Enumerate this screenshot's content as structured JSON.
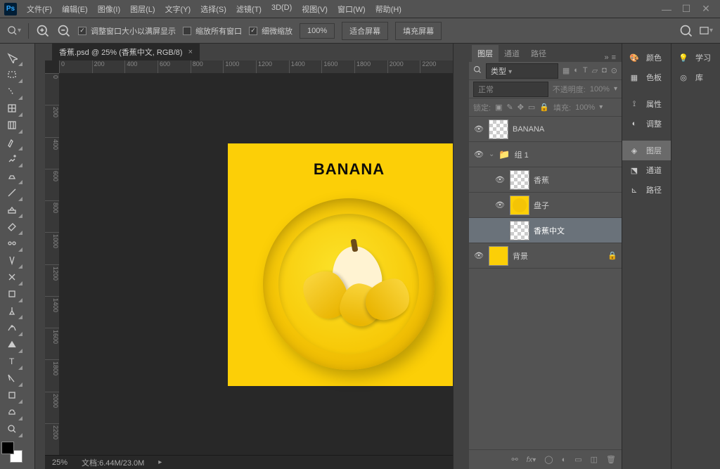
{
  "menubar": {
    "items": [
      "文件(F)",
      "编辑(E)",
      "图像(I)",
      "图层(L)",
      "文字(Y)",
      "选择(S)",
      "滤镜(T)",
      "3D(D)",
      "视图(V)",
      "窗口(W)",
      "帮助(H)"
    ]
  },
  "options": {
    "resize_windows": "调整窗口大小以满屏显示",
    "zoom_all": "缩放所有窗口",
    "scrubby": "细微缩放",
    "zoom_value": "100%",
    "fit_screen": "适合屏幕",
    "fill_screen": "填充屏幕"
  },
  "document": {
    "tab_title": "香蕉.psd @ 25% (香蕉中文, RGB/8)",
    "canvas_text": "BANANA",
    "status_zoom": "25%",
    "status_doc": "文档:6.44M/23.0M"
  },
  "ruler_h": [
    "0",
    "200",
    "400",
    "600",
    "800",
    "1000",
    "1200",
    "1400",
    "1600",
    "1800",
    "2000",
    "2200"
  ],
  "ruler_v": [
    "0",
    "200",
    "400",
    "600",
    "800",
    "1000",
    "1200",
    "1400",
    "1600",
    "1800",
    "2000",
    "2200"
  ],
  "layers_panel": {
    "tabs": [
      "图层",
      "通道",
      "路径"
    ],
    "kind_label": "类型",
    "blend_mode": "正常",
    "opacity_label": "不透明度:",
    "opacity_value": "100%",
    "lock_label": "锁定:",
    "fill_label": "填充:",
    "fill_value": "100%",
    "layers": [
      {
        "name": "BANANA",
        "visible": true,
        "thumb": "checker",
        "indent": 0
      },
      {
        "name": "组 1",
        "visible": true,
        "thumb": "folder",
        "indent": 0,
        "expanded": true
      },
      {
        "name": "香蕉",
        "visible": true,
        "thumb": "checker",
        "indent": 2
      },
      {
        "name": "盘子",
        "visible": true,
        "thumb": "plate",
        "indent": 2
      },
      {
        "name": "香蕉中文",
        "visible": false,
        "thumb": "checker",
        "indent": 2,
        "selected": true
      },
      {
        "name": "背景",
        "visible": true,
        "thumb": "yellow",
        "indent": 0,
        "locked": true
      }
    ]
  },
  "right_rails": {
    "col1": [
      {
        "label": "颜色",
        "icon": "palette"
      },
      {
        "label": "色板",
        "icon": "grid"
      },
      {
        "label": "属性",
        "icon": "props"
      },
      {
        "label": "调整",
        "icon": "adjust"
      },
      {
        "label": "图层",
        "icon": "layers",
        "active": true
      },
      {
        "label": "通道",
        "icon": "channels"
      },
      {
        "label": "路径",
        "icon": "paths"
      }
    ],
    "col2": [
      {
        "label": "学习",
        "icon": "bulb"
      },
      {
        "label": "库",
        "icon": "cc"
      }
    ]
  }
}
